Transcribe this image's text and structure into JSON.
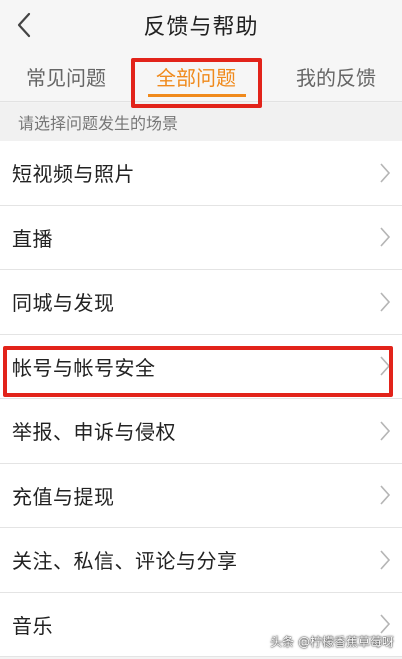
{
  "header": {
    "title": "反馈与帮助",
    "back_icon": "chevron-left-icon"
  },
  "tabs": [
    {
      "label": "常见问题",
      "active": false
    },
    {
      "label": "全部问题",
      "active": true
    },
    {
      "label": "我的反馈",
      "active": false
    }
  ],
  "section": {
    "prompt": "请选择问题发生的场景"
  },
  "items": [
    {
      "label": "短视频与照片"
    },
    {
      "label": "直播"
    },
    {
      "label": "同城与发现"
    },
    {
      "label": "帐号与帐号安全"
    },
    {
      "label": "举报、申诉与侵权"
    },
    {
      "label": "充值与提现"
    },
    {
      "label": "关注、私信、评论与分享"
    },
    {
      "label": "音乐"
    }
  ],
  "watermark": {
    "text": "头条 @柠檬香蕉草莓呀"
  },
  "colors": {
    "accent": "#f08a1c",
    "highlight": "#e2231a"
  }
}
